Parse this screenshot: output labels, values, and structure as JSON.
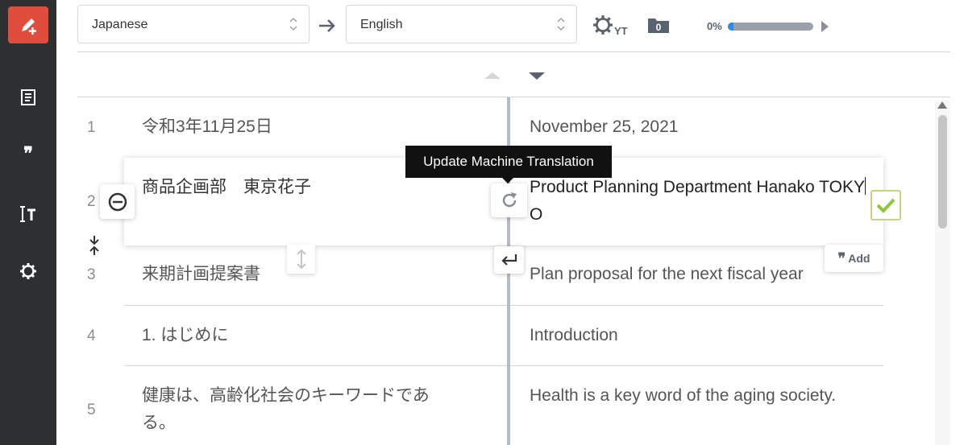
{
  "sidebar": {
    "items": [
      {
        "icon": "pen-plus-icon",
        "active": true
      },
      {
        "icon": "document-icon"
      },
      {
        "icon": "quote-icon"
      },
      {
        "icon": "text-cursor-icon"
      },
      {
        "icon": "gear-icon"
      }
    ]
  },
  "toolbar": {
    "source_language": "Japanese",
    "target_language": "English",
    "gear_label": "YT",
    "folder_count": "0",
    "progress_label": "0%",
    "progress_value": 0.07
  },
  "tooltip": "Update Machine Translation",
  "rows": [
    {
      "num": "1",
      "source": "令和3年11月25日",
      "target": "November 25, 2021"
    },
    {
      "num": "2",
      "source": "商品企画部　東京花子",
      "target_before_caret": "Product Planning Department Hanako TOKY",
      "target_after_caret": "O"
    },
    {
      "num": "3",
      "source": "来期計画提案書",
      "target": "Plan proposal for the next fiscal year"
    },
    {
      "num": "4",
      "source": "1. はじめに",
      "target": "Introduction"
    },
    {
      "num": "5",
      "source": "健康は、高齢化社会のキーワードである。",
      "target": "Health is a key word of the aging society."
    }
  ],
  "add_button": "Add",
  "colors": {
    "accent": "#e14d3d",
    "sidebar": "#2d2f31",
    "progress": "#2c8de6",
    "confirm": "#8dc63f"
  }
}
